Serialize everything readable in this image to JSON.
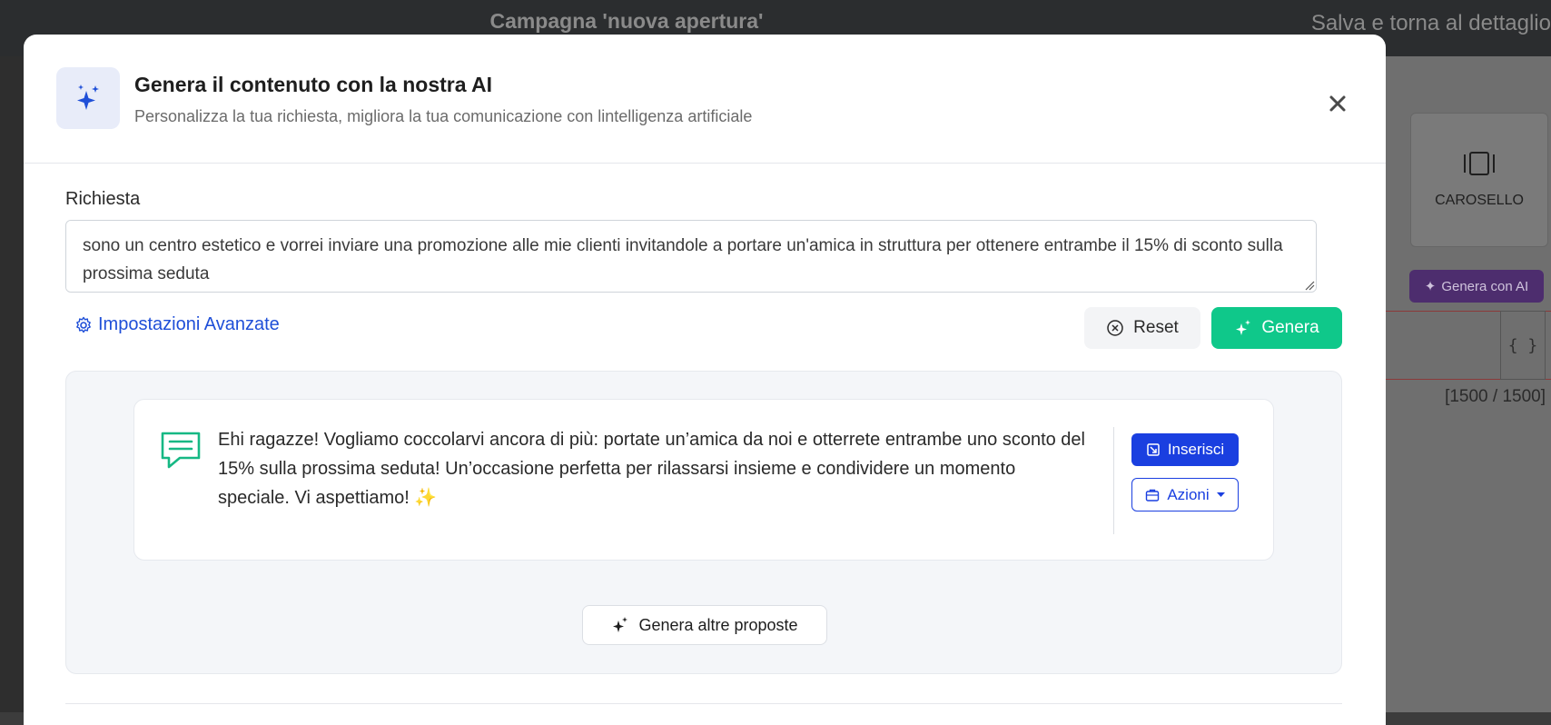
{
  "background": {
    "campaign_title": "Campagna 'nuova apertura'",
    "save_back_label": "Salva e torna al dettaglio",
    "carousel_label": "CAROSELLO",
    "ai_button_label": "Genera con AI",
    "braces_label": "{ }",
    "char_counter": "[1500 / 1500]"
  },
  "modal": {
    "title": "Genera il contenuto con la nostra AI",
    "subtitle": "Personalizza la tua richiesta, migliora la tua comunicazione con lintelligenza artificiale",
    "request_label": "Richiesta",
    "request_value": "sono un centro estetico e vorrei inviare una promozione alle mie clienti invitandole a portare un'amica in struttura per ottenere entrambe il 15% di sconto sulla prossima seduta",
    "advanced_settings_label": "Impostazioni Avanzate",
    "reset_label": "Reset",
    "generate_label": "Genera",
    "proposal": {
      "text": "Ehi ragazze! Vogliamo coccolarvi ancora di più: portate un’amica da noi e otterrete entrambe uno sconto del 15% sulla prossima seduta! Un’occasione perfetta per rilassarsi insieme e condividere un momento speciale. Vi aspettiamo! ✨",
      "insert_label": "Inserisci",
      "actions_label": "Azioni"
    },
    "more_proposals_label": "Genera altre proposte"
  },
  "colors": {
    "accent_blue": "#1a3fe0",
    "generate_green": "#0fc88a",
    "proposal_icon_green": "#16b884"
  }
}
